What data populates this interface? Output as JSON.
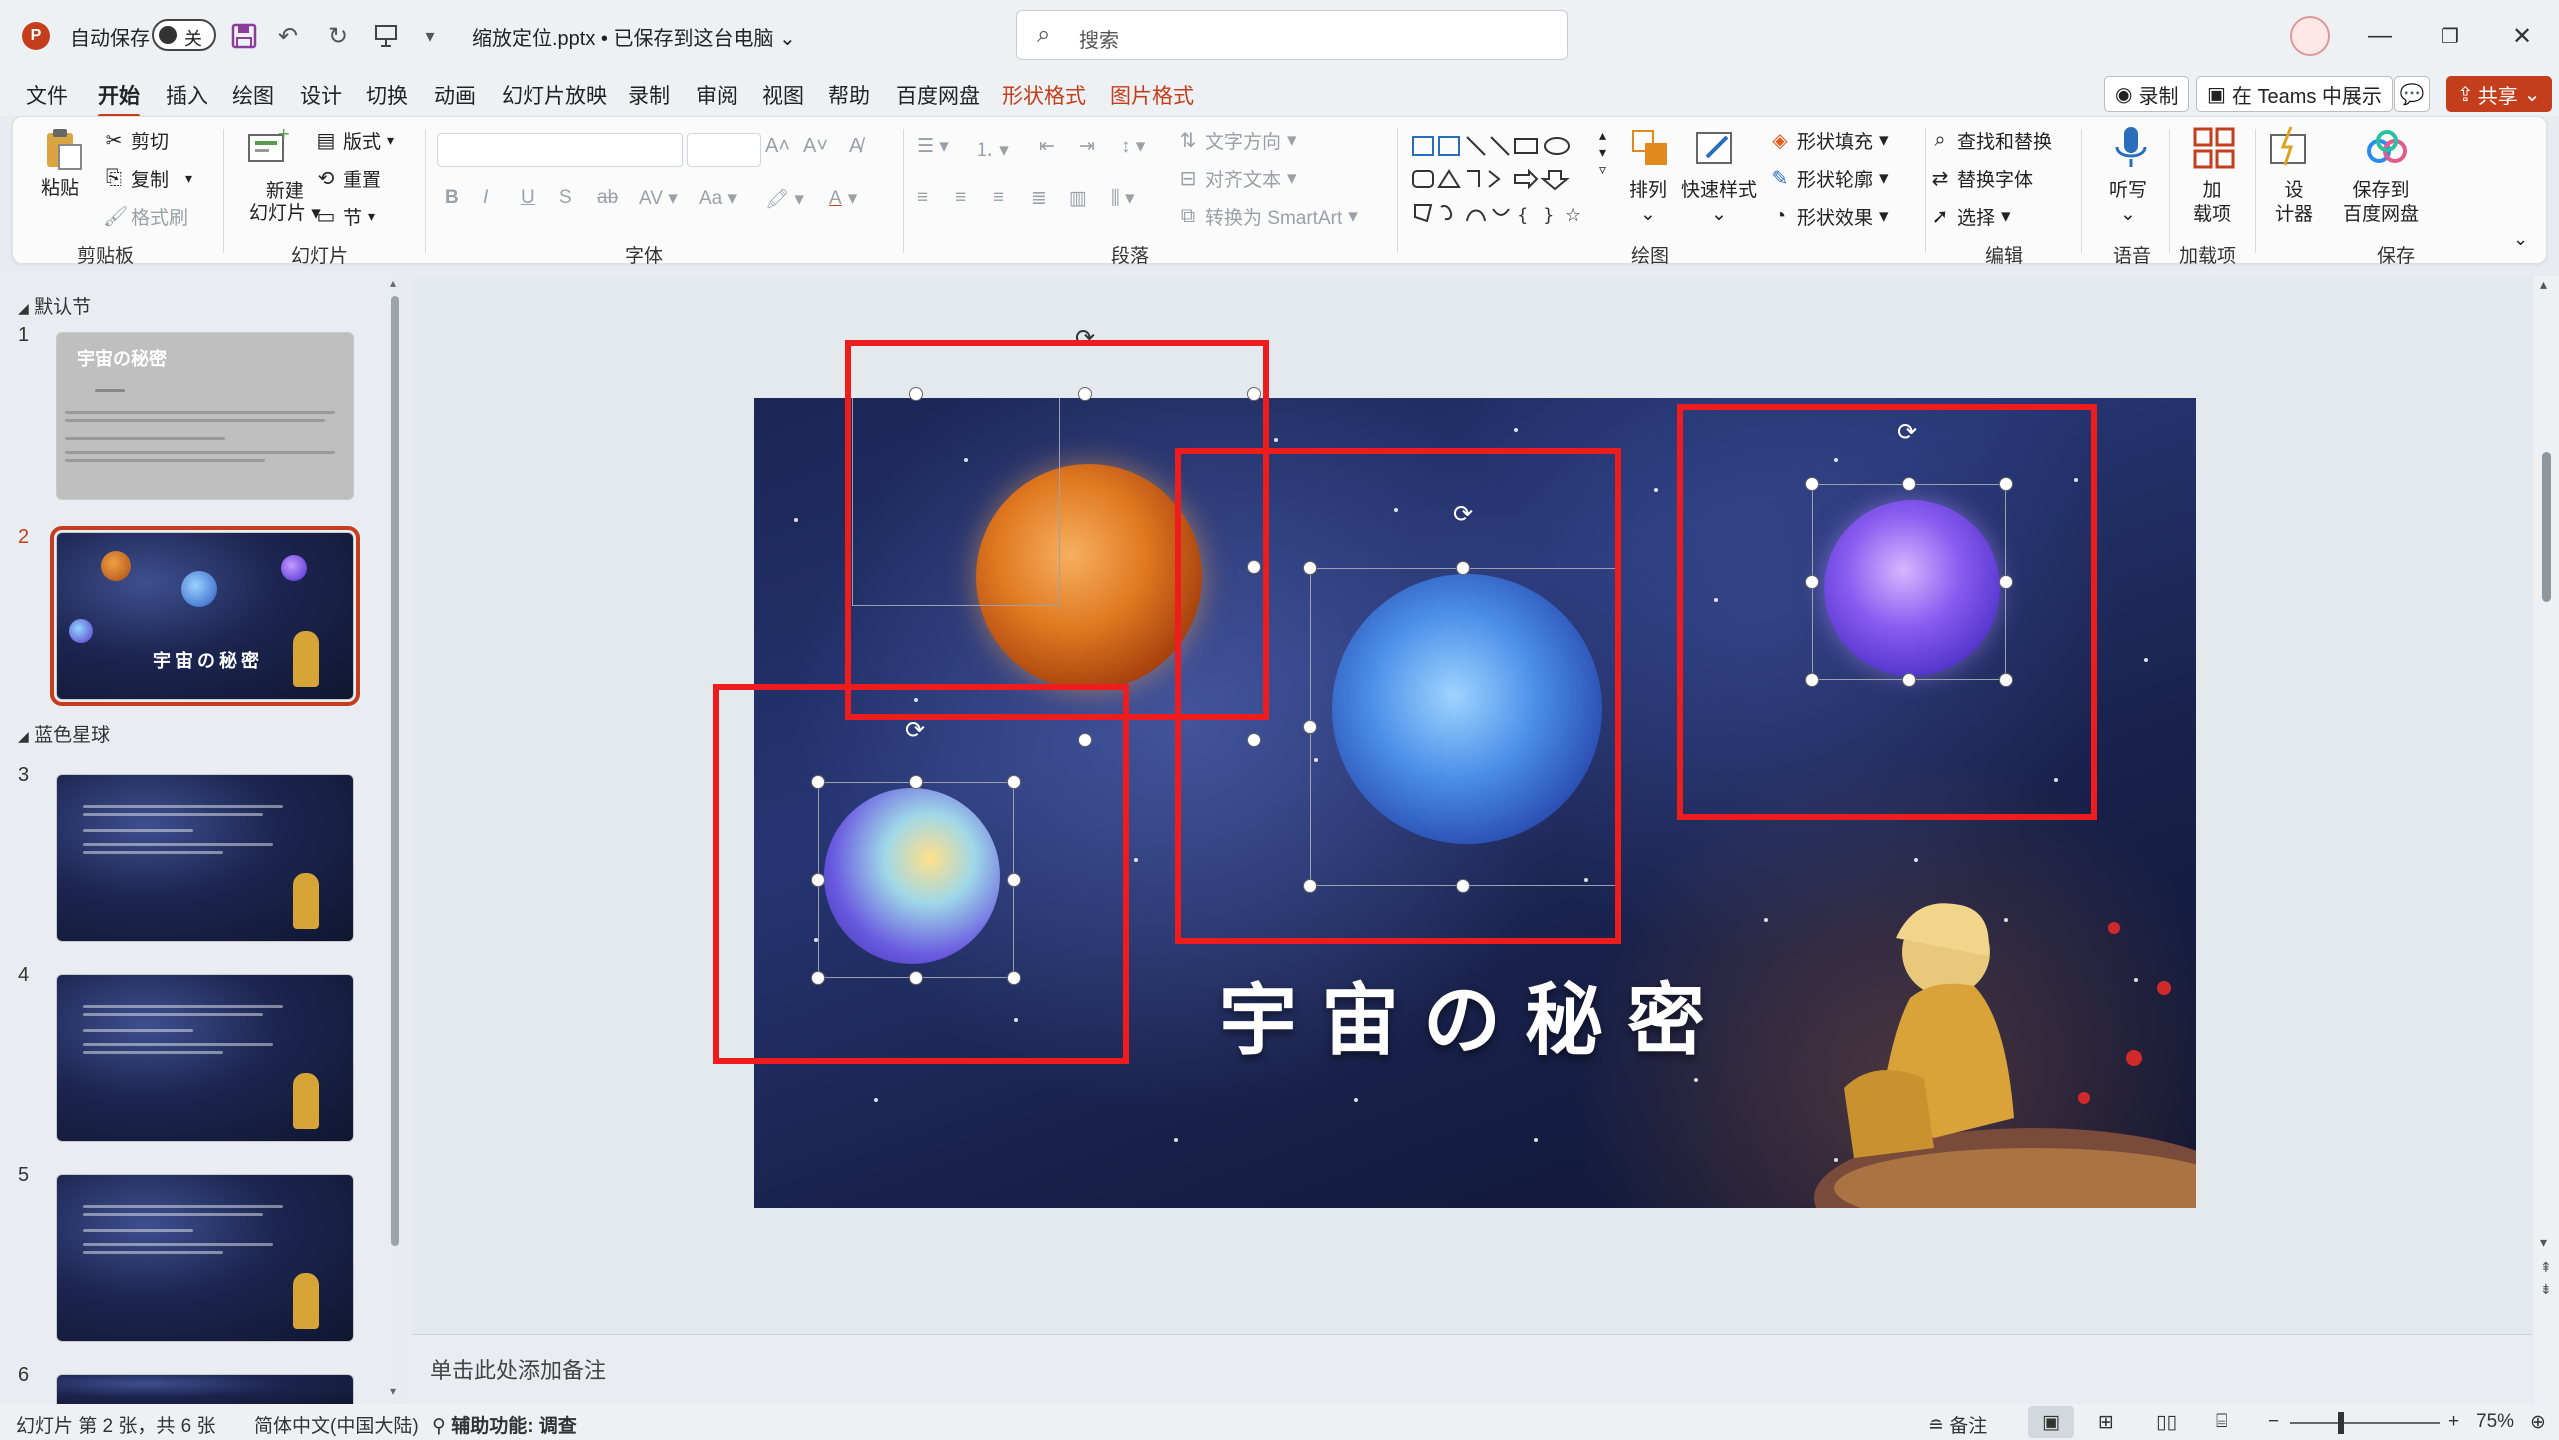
{
  "titlebar": {
    "autosave_label": "自动保存",
    "toggle_state": "关",
    "filename": "缩放定位.pptx • 已保存到这台电脑 ⌄",
    "search_placeholder": "搜索"
  },
  "menu": {
    "tabs": [
      "文件",
      "开始",
      "插入",
      "绘图",
      "设计",
      "切换",
      "动画",
      "幻灯片放映",
      "录制",
      "审阅",
      "视图",
      "帮助",
      "百度网盘",
      "形状格式",
      "图片格式"
    ],
    "active_tab": "开始",
    "record_label": "录制",
    "teams_label": "在 Teams 中展示",
    "share_label": "共享"
  },
  "ribbon": {
    "clipboard": {
      "paste": "粘贴",
      "cut": "剪切",
      "copy": "复制",
      "format_painter": "格式刷",
      "label": "剪贴板"
    },
    "slides": {
      "new_slide_1": "新建",
      "new_slide_2": "幻灯片",
      "layout": "版式",
      "reset": "重置",
      "section": "节",
      "label": "幻灯片"
    },
    "font": {
      "label": "字体"
    },
    "paragraph": {
      "text_direction": "文字方向",
      "align_text": "对齐文本",
      "smartart": "转换为 SmartArt",
      "label": "段落"
    },
    "drawing": {
      "arrange": "排列",
      "quick_styles": "快速样式",
      "shape_fill": "形状填充",
      "shape_outline": "形状轮廓",
      "shape_effects": "形状效果",
      "label": "绘图"
    },
    "editing": {
      "find_replace": "查找和替换",
      "replace_font": "替换字体",
      "select": "选择",
      "label": "编辑"
    },
    "voice": {
      "dictate": "听写",
      "label": "语音"
    },
    "addins": {
      "addins_1": "加",
      "addins_2": "载项",
      "label": "加载项"
    },
    "designer": {
      "d1": "设",
      "d2": "计器"
    },
    "save": {
      "s1": "保存到",
      "s2": "百度网盘",
      "label": "保存"
    }
  },
  "thumbnails": {
    "section_default": "默认节",
    "section_blue": "蓝色星球",
    "slide1_title": "宇宙の秘密",
    "slide2_title": "宇宙の秘密",
    "numbers": [
      "1",
      "2",
      "3",
      "4",
      "5",
      "6"
    ]
  },
  "slide": {
    "title": "宇宙の秘密"
  },
  "notes_placeholder": "单击此处添加备注",
  "statusbar": {
    "slide_info": "幻灯片 第 2 张，共 6 张",
    "language": "简体中文(中国大陆)",
    "accessibility": "辅助功能: 调查",
    "notes": "备注",
    "zoom": "75%"
  },
  "colors": {
    "accent": "#c43e1c",
    "annotation_red": "#ee1c1c"
  }
}
